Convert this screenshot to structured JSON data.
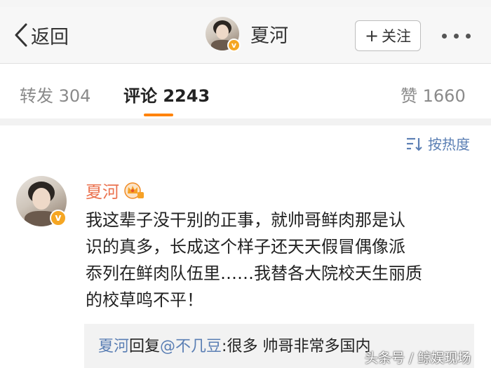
{
  "nav": {
    "back_label": "返回",
    "title": "夏河",
    "follow_label": "关注",
    "follow_plus": "+",
    "vbadge": "v"
  },
  "tabs": [
    {
      "label": "转发",
      "count": "304",
      "active": false
    },
    {
      "label": "评论",
      "count": "2243",
      "active": true
    },
    {
      "label": "赞",
      "count": "1660",
      "active": false
    }
  ],
  "sort": {
    "label": "按热度",
    "icon": "sort-lines-icon"
  },
  "comment": {
    "author": "夏河",
    "vbadge": "v",
    "lines": [
      "我这辈子没干别的正事，就帅哥鲜肉那是认",
      "识的真多，长成这个样子还天天假冒偶像派",
      "忝列在鲜肉队伍里……我替各大院校天生丽质",
      "的校草鸣不平！"
    ],
    "reply": {
      "author": "夏河",
      "verb": "回复",
      "mention": "@不几豆",
      "text": ":很多  帅哥非常多国内"
    }
  },
  "watermark": "头条号 / 鲸娱现场",
  "colors": {
    "accent": "#ff8200",
    "name": "#eb7350",
    "link": "#5b7fb4",
    "badge": "#f5a623"
  }
}
